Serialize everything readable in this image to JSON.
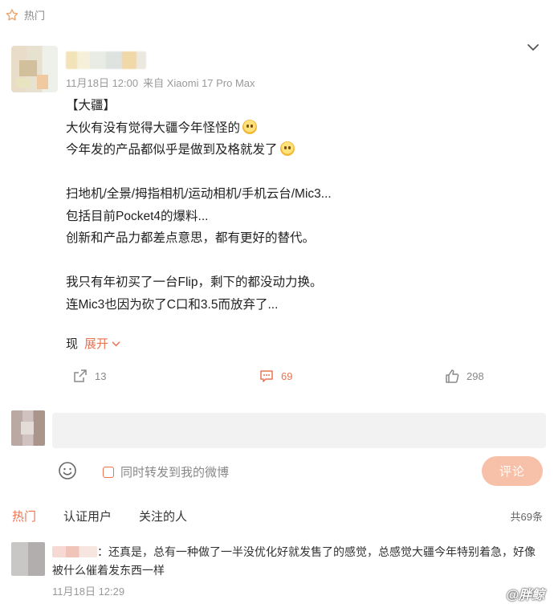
{
  "hot_tag": {
    "label": "热门",
    "icon": "star-outline-icon"
  },
  "post": {
    "timestamp": "11月18日 12:00",
    "source": "来自 Xiaomi 17 Pro Max",
    "lines": [
      "【大疆】",
      "大伙有没有觉得大疆今年怪怪的",
      "今年发的产品都似乎是做到及格就发了",
      "",
      "扫地机/全景/拇指相机/运动相机/手机云台/Mic3...",
      "包括目前Pocket4的爆料...",
      "创新和产品力都差点意思，都有更好的替代。",
      "",
      "我只有年初买了一台Flip，剩下的都没动力换。",
      "连Mic3也因为砍了C口和3.5而放弃了..."
    ],
    "truncated_text": "现",
    "expand_label": "展开",
    "share_count": "13",
    "comment_count": "69",
    "like_count": "298"
  },
  "composer": {
    "placeholder": "",
    "repost_label": "同时转发到我的微博",
    "submit_label": "评论"
  },
  "comments": {
    "tabs": [
      "热门",
      "认证用户",
      "关注的人"
    ],
    "active_tab": 0,
    "total": "共69条",
    "items": [
      {
        "text": "：还真是，总有一种做了一半没优化好就发售了的感觉，总感觉大疆今年特别着急，好像被什么催着发东西一样",
        "time": "11月18日 12:29"
      }
    ]
  },
  "watermark": "@胖鲸",
  "colors": {
    "accent": "#eb7350",
    "muted": "#999999"
  }
}
